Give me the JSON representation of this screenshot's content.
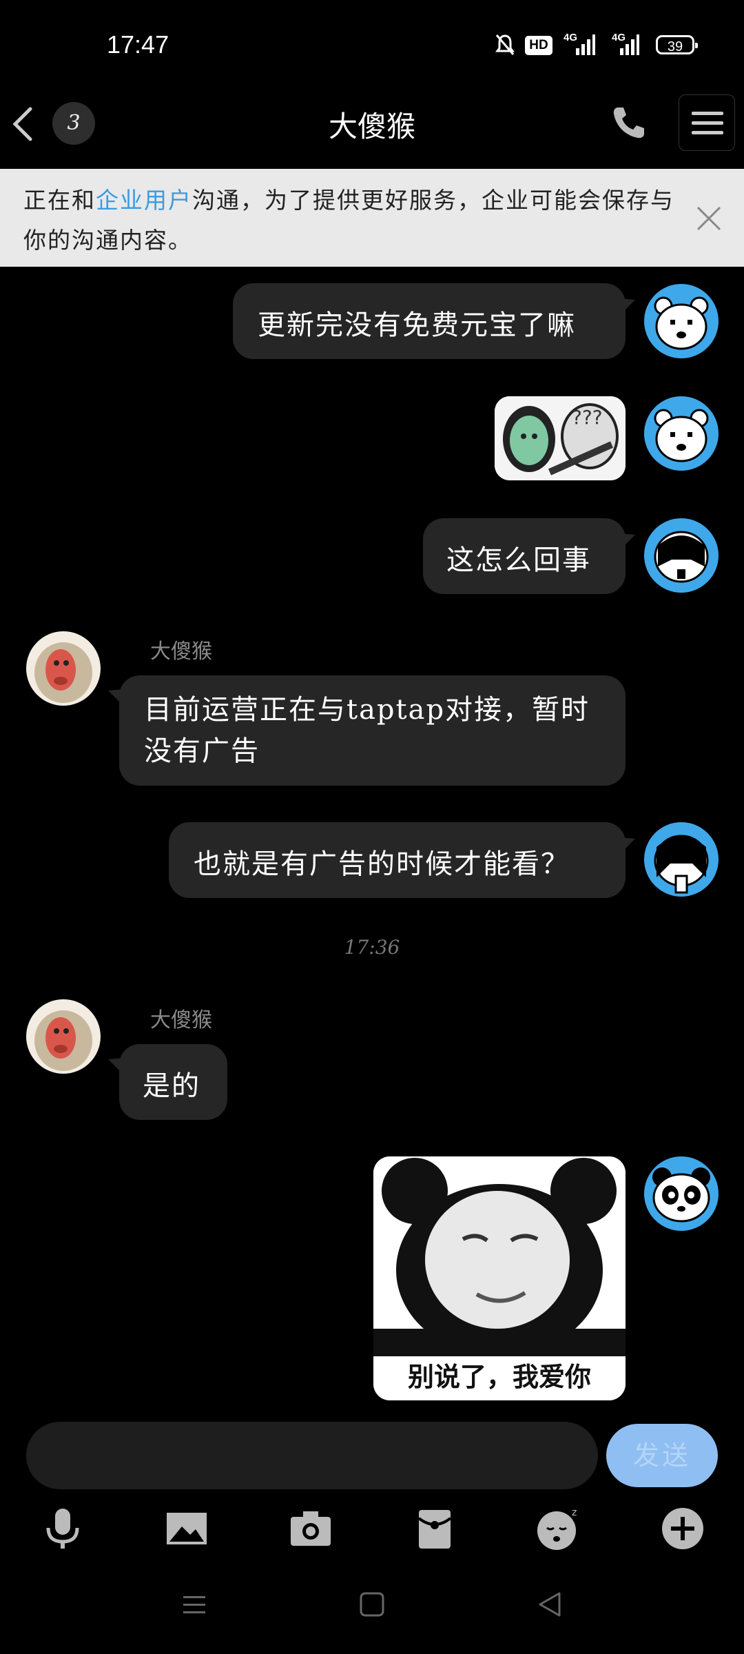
{
  "status_bar": {
    "time": "17:47",
    "battery": "39",
    "hd": "HD",
    "net1": "4G",
    "net2": "4G"
  },
  "header": {
    "unread_count": "3",
    "title": "大傻猴"
  },
  "notice": {
    "prefix": "正在和",
    "highlight": "企业用户",
    "suffix": "沟通，为了提供更好服务，企业可能会保存与你的沟通内容。"
  },
  "messages": [
    {
      "side": "right",
      "type": "text",
      "text": "更新完没有免费元宝了嘛"
    },
    {
      "side": "right",
      "type": "sticker",
      "sticker": "panda-meme-small"
    },
    {
      "side": "right",
      "type": "text",
      "text": "这怎么回事"
    },
    {
      "side": "left",
      "type": "text",
      "sender": "大傻猴",
      "text": "目前运营正在与taptap对接，暂时没有广告"
    },
    {
      "side": "right",
      "type": "text",
      "text": "也就是有广告的时候才能看？"
    },
    {
      "side": "left",
      "type": "text",
      "sender": "大傻猴",
      "text": "是的"
    },
    {
      "side": "right",
      "type": "sticker",
      "sticker": "panda-meme-love",
      "caption": "别说了，我爱你"
    }
  ],
  "timestamp": "17:36",
  "composer": {
    "send_label": "发送"
  },
  "colors": {
    "accent": "#3a9be0",
    "bubble": "#262626",
    "send": "#8fbef2",
    "avatar_bg": "#3fa8ea"
  }
}
